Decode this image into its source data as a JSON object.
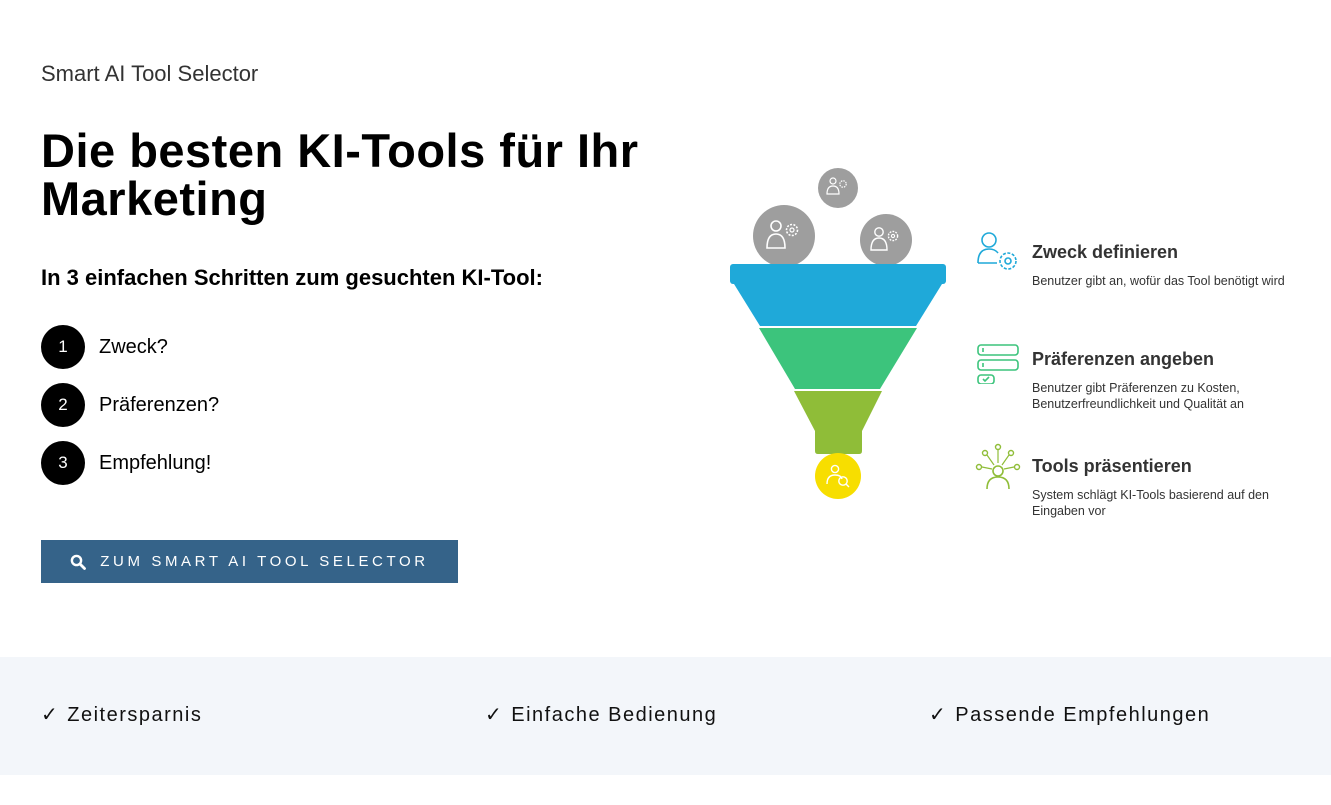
{
  "header": {
    "eyebrow": "Smart AI Tool Selector",
    "title": "Die besten KI-Tools für Ihr Marketing",
    "subheading": "In 3 einfachen Schritten zum gesuchten KI-Tool:"
  },
  "steps": [
    {
      "number": "1",
      "label": "Zweck?"
    },
    {
      "number": "2",
      "label": "Präferenzen?"
    },
    {
      "number": "3",
      "label": "Empfehlung!"
    }
  ],
  "cta": {
    "label": "ZUM SMART AI TOOL SELECTOR",
    "icon": "search-icon"
  },
  "funnel": {
    "colors": {
      "top": "#1fa9d9",
      "middle": "#3cc47c",
      "bottom": "#8fbd38",
      "output": "#f7de00",
      "bubbles": "#9e9e9e"
    }
  },
  "features": [
    {
      "title": "Zweck definieren",
      "description": "Benutzer gibt an, wofür das Tool benötigt wird",
      "icon": "user-gear-icon",
      "color": "#1fa9d9"
    },
    {
      "title": "Präferenzen angeben",
      "description": "Benutzer gibt Präferenzen zu Kosten, Benutzerfreundlichkeit und Qualität an",
      "icon": "preferences-list-icon",
      "color": "#3cc47c"
    },
    {
      "title": "Tools präsentieren",
      "description": "System schlägt KI-Tools basierend auf den Eingaben vor",
      "icon": "network-user-icon",
      "color": "#8fbd38"
    }
  ],
  "benefits": [
    {
      "check": "✓",
      "label": "Zeitersparnis"
    },
    {
      "check": "✓",
      "label": "Einfache Bedienung"
    },
    {
      "check": "✓",
      "label": "Passende Empfehlungen"
    }
  ],
  "colors": {
    "cta_background": "#356389",
    "benefits_background": "#f3f6fa"
  }
}
